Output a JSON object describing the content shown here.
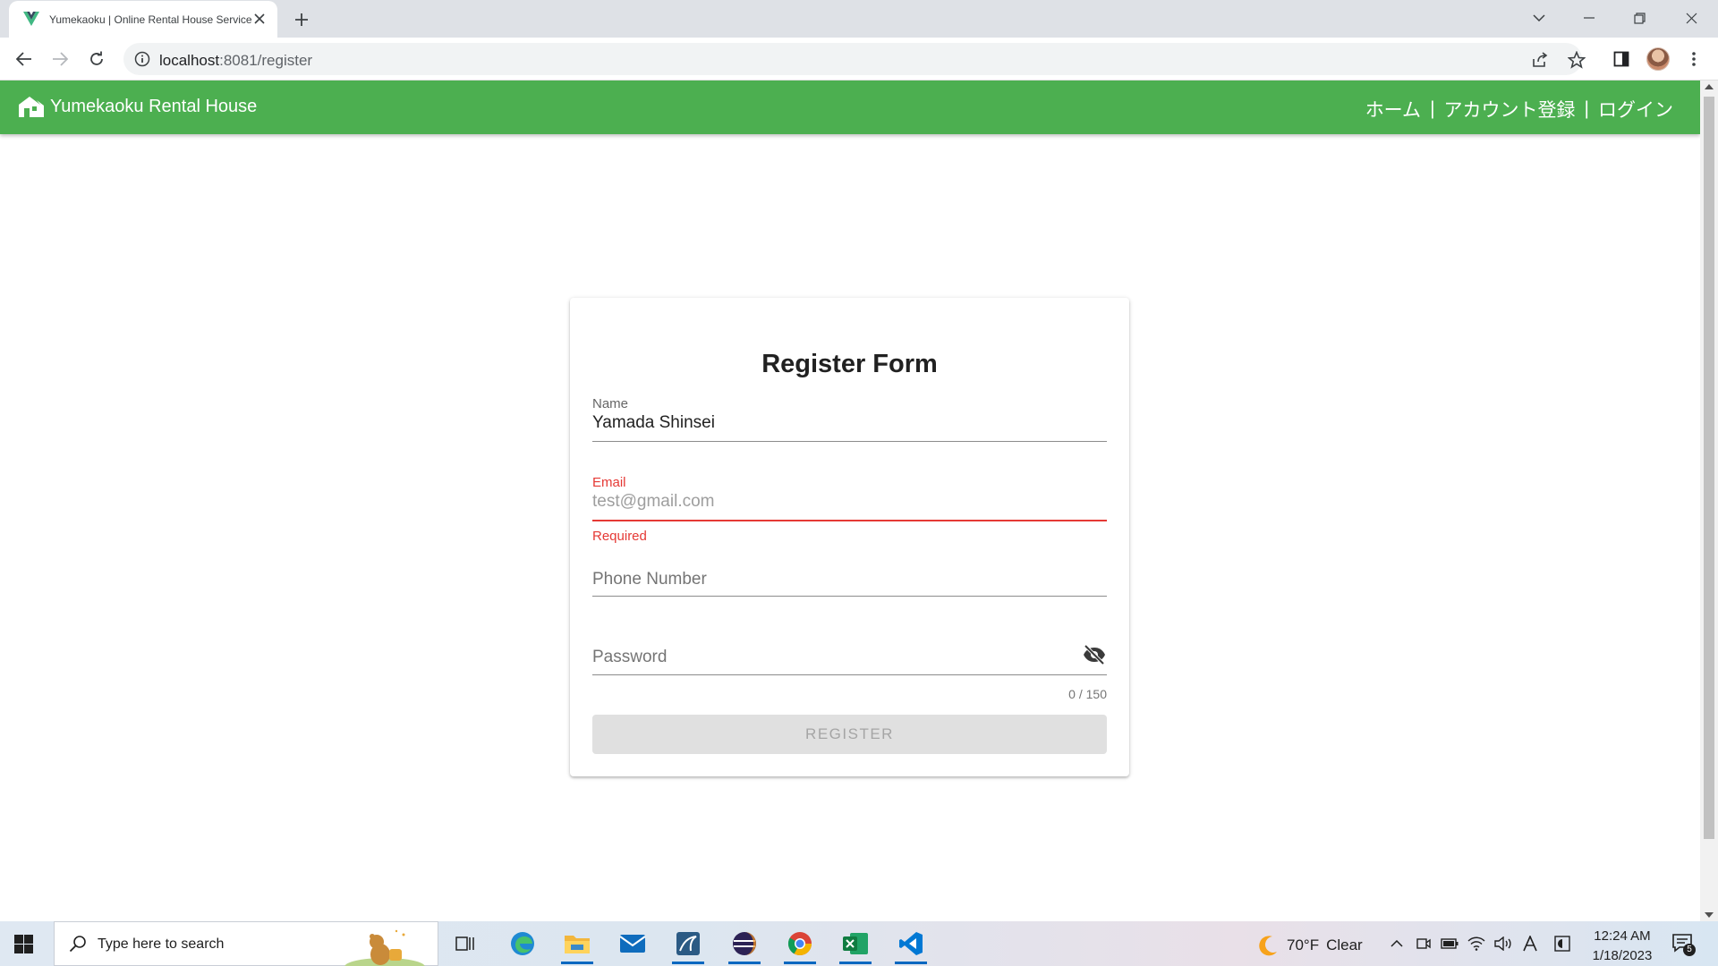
{
  "browser": {
    "tab_title": "Yumekaoku | Online Rental House Service",
    "url_host": "localhost",
    "url_path": ":8081/register"
  },
  "app": {
    "brand": "Yumekaoku Rental House",
    "nav": {
      "home": "ホーム",
      "register": "アカウント登録",
      "login": "ログイン",
      "separator": "|"
    },
    "colors": {
      "appbar": "#4caf50",
      "error": "#e53935"
    }
  },
  "form": {
    "title": "Register Form",
    "name": {
      "label": "Name",
      "value": "Yamada Shinsei"
    },
    "email": {
      "label": "Email",
      "value": "test@gmail.com",
      "error": "Required"
    },
    "phone": {
      "label": "Phone Number"
    },
    "password": {
      "label": "Password",
      "counter": "0 / 150"
    },
    "submit_label": "REGISTER"
  },
  "taskbar": {
    "search_placeholder": "Type here to search",
    "weather": {
      "temp": "70°F",
      "condition": "Clear"
    },
    "time": "12:24 AM",
    "date": "1/18/2023",
    "notification_count": "5"
  }
}
